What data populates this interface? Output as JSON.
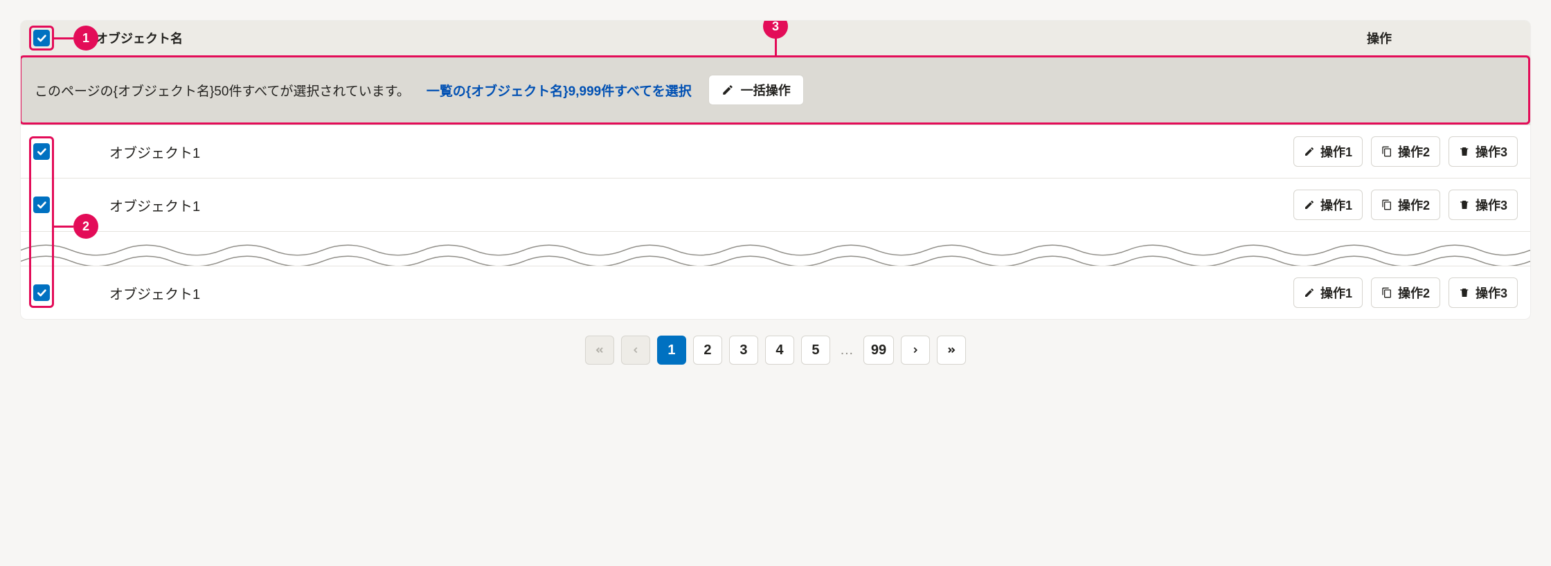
{
  "header": {
    "name_col": "オブジェクト名",
    "ops_col": "操作"
  },
  "bulk": {
    "text": "このページの{オブジェクト名}50件すべてが選択されています。",
    "link": "一覧の{オブジェクト名}9,999件すべてを選択",
    "button": "一括操作"
  },
  "rows": [
    {
      "name": "オブジェクト1"
    },
    {
      "name": "オブジェクト1"
    },
    {
      "name": "オブジェクト1"
    }
  ],
  "row_ops": {
    "op1": "操作1",
    "op2": "操作2",
    "op3": "操作3"
  },
  "pagination": {
    "pages": [
      "1",
      "2",
      "3",
      "4",
      "5"
    ],
    "ellipsis": "…",
    "last": "99"
  },
  "annotations": {
    "a1": "1",
    "a2": "2",
    "a3": "3"
  }
}
